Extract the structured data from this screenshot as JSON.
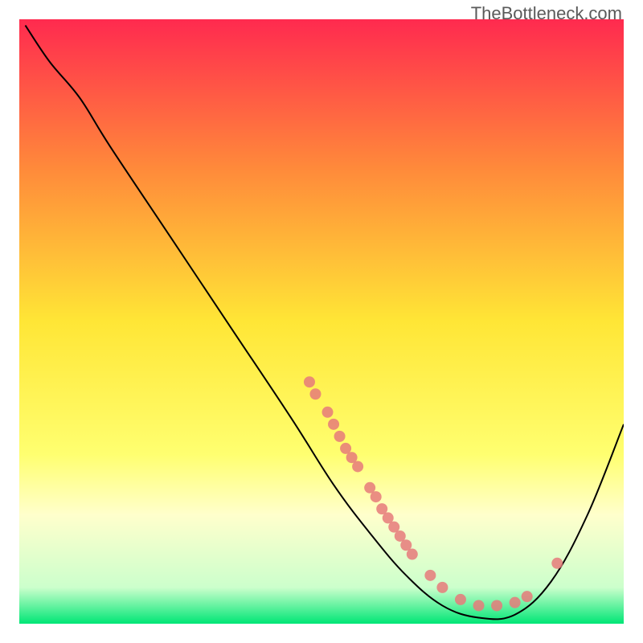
{
  "watermark": "TheBottleneck.com",
  "chart_data": {
    "type": "line",
    "title": "",
    "xlabel": "",
    "ylabel": "",
    "xlim": [
      0,
      100
    ],
    "ylim": [
      0,
      100
    ],
    "gradient_stops": [
      {
        "offset": 0,
        "color": "#ff2a4f"
      },
      {
        "offset": 0.25,
        "color": "#ff8b3a"
      },
      {
        "offset": 0.5,
        "color": "#ffe636"
      },
      {
        "offset": 0.72,
        "color": "#ffff70"
      },
      {
        "offset": 0.82,
        "color": "#ffffcc"
      },
      {
        "offset": 0.94,
        "color": "#ccffcc"
      },
      {
        "offset": 1.0,
        "color": "#00e676"
      }
    ],
    "curve_points": [
      {
        "x": 1,
        "y": 99
      },
      {
        "x": 5,
        "y": 93
      },
      {
        "x": 10,
        "y": 87
      },
      {
        "x": 15,
        "y": 79
      },
      {
        "x": 25,
        "y": 64
      },
      {
        "x": 35,
        "y": 49
      },
      {
        "x": 45,
        "y": 34
      },
      {
        "x": 52,
        "y": 23
      },
      {
        "x": 58,
        "y": 15
      },
      {
        "x": 64,
        "y": 8
      },
      {
        "x": 70,
        "y": 3
      },
      {
        "x": 76,
        "y": 1
      },
      {
        "x": 82,
        "y": 1.5
      },
      {
        "x": 88,
        "y": 7
      },
      {
        "x": 94,
        "y": 18
      },
      {
        "x": 100,
        "y": 33
      }
    ],
    "scatter_points": [
      {
        "x": 48,
        "y": 40
      },
      {
        "x": 49,
        "y": 38
      },
      {
        "x": 51,
        "y": 35
      },
      {
        "x": 52,
        "y": 33
      },
      {
        "x": 53,
        "y": 31
      },
      {
        "x": 54,
        "y": 29
      },
      {
        "x": 55,
        "y": 27.5
      },
      {
        "x": 56,
        "y": 26
      },
      {
        "x": 58,
        "y": 22.5
      },
      {
        "x": 59,
        "y": 21
      },
      {
        "x": 60,
        "y": 19
      },
      {
        "x": 61,
        "y": 17.5
      },
      {
        "x": 62,
        "y": 16
      },
      {
        "x": 63,
        "y": 14.5
      },
      {
        "x": 64,
        "y": 13
      },
      {
        "x": 65,
        "y": 11.5
      },
      {
        "x": 68,
        "y": 8
      },
      {
        "x": 70,
        "y": 6
      },
      {
        "x": 73,
        "y": 4
      },
      {
        "x": 76,
        "y": 3
      },
      {
        "x": 79,
        "y": 3
      },
      {
        "x": 82,
        "y": 3.5
      },
      {
        "x": 84,
        "y": 4.5
      },
      {
        "x": 89,
        "y": 10
      }
    ]
  }
}
